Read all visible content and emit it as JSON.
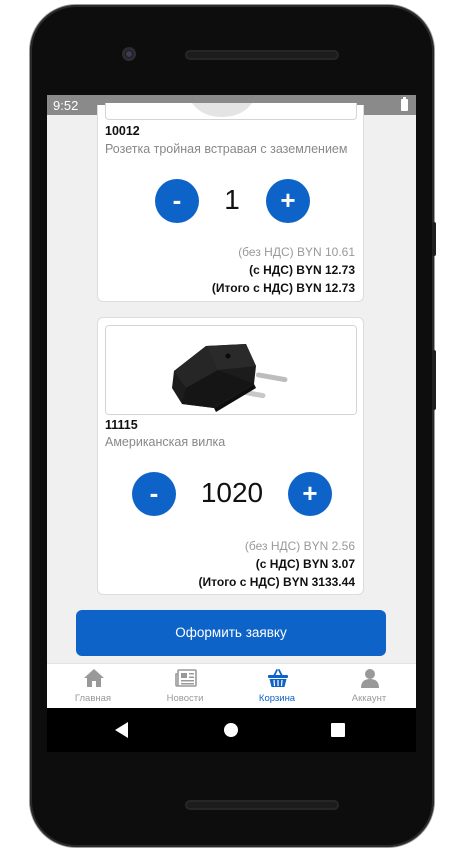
{
  "status_bar": {
    "time": "9:52"
  },
  "cart": {
    "items": [
      {
        "code": "10012",
        "name": "Розетка тройная встравая с заземлением",
        "quantity": "1",
        "minus_label": "-",
        "plus_label": "+",
        "price_no_vat": "(без НДС) BYN 10.61",
        "price_vat": "(с НДС) BYN 12.73",
        "total_vat": "(Итого с НДС) BYN 12.73"
      },
      {
        "code": "11115",
        "name": "Американская вилка",
        "quantity": "1020",
        "minus_label": "-",
        "plus_label": "+",
        "price_no_vat": "(без НДС) BYN 2.56",
        "price_vat": "(с НДС) BYN 3.07",
        "total_vat": "(Итого с НДС) BYN 3133.44"
      }
    ],
    "order_button": "Оформить заявку"
  },
  "tabs": [
    {
      "label": "Главная",
      "icon": "home-icon",
      "active": false
    },
    {
      "label": "Новости",
      "icon": "newspaper-icon",
      "active": false
    },
    {
      "label": "Корзина",
      "icon": "basket-icon",
      "active": true
    },
    {
      "label": "Аккаунт",
      "icon": "user-icon",
      "active": false
    }
  ],
  "colors": {
    "accent": "#0d63c8",
    "muted": "#999999",
    "status_bar": "#8a8a8a"
  }
}
